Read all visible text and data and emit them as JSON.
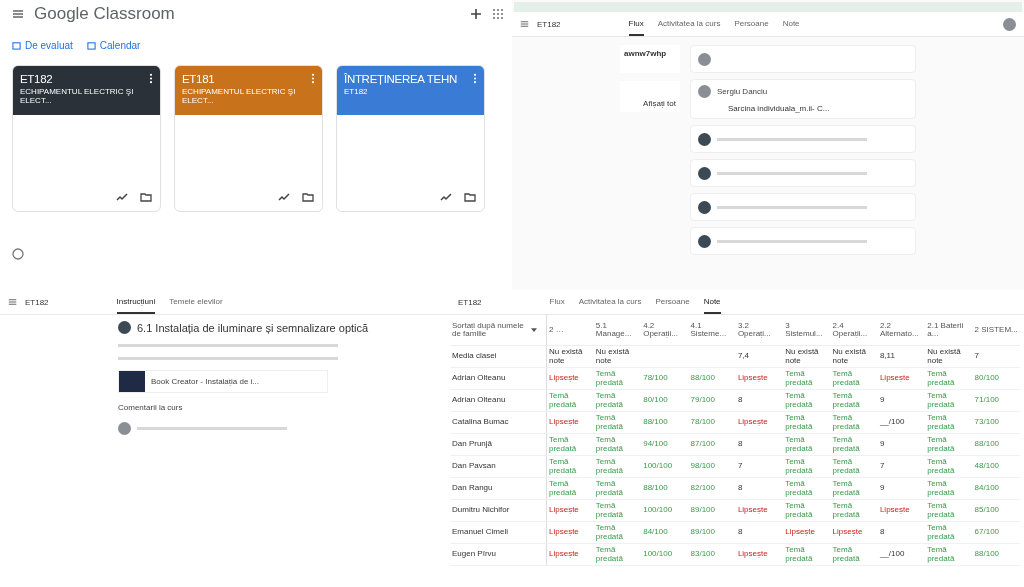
{
  "home": {
    "app_title": "Google Classroom",
    "links": [
      "De evaluat",
      "Calendar"
    ],
    "cards": [
      {
        "title": "ET182",
        "subtitle": "ECHIPAMENTUL ELECTRIC ŞI ELECT...",
        "color": "#2b3138"
      },
      {
        "title": "ET181",
        "subtitle": "ECHIPAMENTUL ELECTRIC ŞI ELECT...",
        "color": "#c8731c"
      },
      {
        "title": "ÎNTREȚINEREA TEHN",
        "subtitle": "ET182",
        "color": "#3a7bd5"
      }
    ]
  },
  "stream": {
    "class_name": "ET182",
    "tabs": [
      {
        "label": "Flux",
        "selected": true
      },
      {
        "label": "Activitatea la curs",
        "selected": false
      },
      {
        "label": "Persoane",
        "selected": false
      },
      {
        "label": "Note",
        "selected": false
      }
    ],
    "class_code": "awnw7whp",
    "view_all": "Afișați tot",
    "post_author": "Sergiu Danciu",
    "attachment": "Sarcina individuala_m.ii- C..."
  },
  "assignment": {
    "class_name": "ET182",
    "tabs": [
      {
        "label": "Instrucțiuni",
        "selected": true
      },
      {
        "label": "Temele elevilor",
        "selected": false
      }
    ],
    "title": "6.1 Instalația de iluminare și semnalizare optică",
    "material": "Book Creator - Instalația de i...",
    "comments": "Comentarii la curs"
  },
  "grades": {
    "class_name": "ET182",
    "tabs": [
      {
        "label": "Flux",
        "selected": false
      },
      {
        "label": "Activitatea la curs",
        "selected": false
      },
      {
        "label": "Persoane",
        "selected": false
      },
      {
        "label": "Note",
        "selected": true
      }
    ],
    "sort": "Sortați după numele de familie",
    "columns": [
      "2 …",
      "5.1 Manage...",
      "4.2 Operații...",
      "4.1 Sisteme...",
      "3.2 Operați...",
      "3 Sistemul...",
      "2.4 Operații...",
      "2.2 Alternato...",
      "2.1 Baterii a...",
      "2 SISTEM..."
    ],
    "rows": [
      {
        "name": "Media clasei",
        "cells": [
          {
            "text": "Nu există note",
            "kind": "plain"
          },
          {
            "text": "Nu există note",
            "kind": "plain"
          },
          {
            "text": "",
            "kind": "plain"
          },
          {
            "text": "",
            "kind": "plain"
          },
          {
            "text": "7,4",
            "kind": "plain"
          },
          {
            "text": "Nu există note",
            "kind": "plain"
          },
          {
            "text": "Nu există note",
            "kind": "plain"
          },
          {
            "text": "8,11",
            "kind": "plain"
          },
          {
            "text": "Nu există note",
            "kind": "plain"
          },
          {
            "text": "7",
            "kind": "plain"
          }
        ]
      },
      {
        "name": "Adrian Olteanu",
        "cells": [
          {
            "text": "Lipsește",
            "kind": "missing"
          },
          {
            "text": "Temă predată",
            "kind": "done"
          },
          {
            "text": "78/100",
            "kind": "done"
          },
          {
            "text": "88/100",
            "kind": "done"
          },
          {
            "text": "Lipsește",
            "kind": "missing"
          },
          {
            "text": "Temă predată",
            "kind": "done"
          },
          {
            "text": "Temă predată",
            "kind": "done"
          },
          {
            "text": "Lipsește",
            "kind": "missing"
          },
          {
            "text": "Temă predată",
            "kind": "done"
          },
          {
            "text": "80/100",
            "kind": "done"
          }
        ]
      },
      {
        "name": "Adrian Olteanu",
        "cells": [
          {
            "text": "Temă predată",
            "kind": "done"
          },
          {
            "text": "Temă predată",
            "kind": "done"
          },
          {
            "text": "80/100",
            "kind": "done"
          },
          {
            "text": "79/100",
            "kind": "done"
          },
          {
            "text": "8",
            "kind": "plain"
          },
          {
            "text": "Temă predată",
            "kind": "done"
          },
          {
            "text": "Temă predată",
            "kind": "done"
          },
          {
            "text": "9",
            "kind": "plain"
          },
          {
            "text": "Temă predată",
            "kind": "done"
          },
          {
            "text": "71/100",
            "kind": "done"
          }
        ]
      },
      {
        "name": "Catalina Bumac",
        "cells": [
          {
            "text": "Lipsește",
            "kind": "missing"
          },
          {
            "text": "Temă predată",
            "kind": "done"
          },
          {
            "text": "88/100",
            "kind": "done"
          },
          {
            "text": "78/100",
            "kind": "done"
          },
          {
            "text": "Lipsește",
            "kind": "missing"
          },
          {
            "text": "Temă predată",
            "kind": "done"
          },
          {
            "text": "Temă predată",
            "kind": "done"
          },
          {
            "text": "__/100",
            "kind": "plain"
          },
          {
            "text": "Temă predată",
            "kind": "done"
          },
          {
            "text": "73/100",
            "kind": "done"
          }
        ]
      },
      {
        "name": "Dan Prunjă",
        "cells": [
          {
            "text": "Temă predată",
            "kind": "done"
          },
          {
            "text": "Temă predată",
            "kind": "done"
          },
          {
            "text": "94/100",
            "kind": "done"
          },
          {
            "text": "87/100",
            "kind": "done"
          },
          {
            "text": "8",
            "kind": "plain"
          },
          {
            "text": "Temă predată",
            "kind": "done"
          },
          {
            "text": "Temă predată",
            "kind": "done"
          },
          {
            "text": "9",
            "kind": "plain"
          },
          {
            "text": "Temă predată",
            "kind": "done"
          },
          {
            "text": "88/100",
            "kind": "done"
          }
        ]
      },
      {
        "name": "Dan Pavsan",
        "cells": [
          {
            "text": "Temă predată",
            "kind": "done"
          },
          {
            "text": "Temă predată",
            "kind": "done"
          },
          {
            "text": "100/100",
            "kind": "done"
          },
          {
            "text": "98/100",
            "kind": "done"
          },
          {
            "text": "7",
            "kind": "plain"
          },
          {
            "text": "Temă predată",
            "kind": "done"
          },
          {
            "text": "Temă predată",
            "kind": "done"
          },
          {
            "text": "7",
            "kind": "plain"
          },
          {
            "text": "Temă predată",
            "kind": "done"
          },
          {
            "text": "48/100",
            "kind": "done"
          }
        ]
      },
      {
        "name": "Dan Rangu",
        "cells": [
          {
            "text": "Temă predată",
            "kind": "done"
          },
          {
            "text": "Temă predată",
            "kind": "done"
          },
          {
            "text": "88/100",
            "kind": "done"
          },
          {
            "text": "82/100",
            "kind": "done"
          },
          {
            "text": "8",
            "kind": "plain"
          },
          {
            "text": "Temă predată",
            "kind": "done"
          },
          {
            "text": "Temă predată",
            "kind": "done"
          },
          {
            "text": "9",
            "kind": "plain"
          },
          {
            "text": "Temă predată",
            "kind": "done"
          },
          {
            "text": "84/100",
            "kind": "done"
          }
        ]
      },
      {
        "name": "Dumitru Nichifor",
        "cells": [
          {
            "text": "Lipsește",
            "kind": "missing"
          },
          {
            "text": "Temă predată",
            "kind": "done"
          },
          {
            "text": "100/100",
            "kind": "done"
          },
          {
            "text": "89/100",
            "kind": "done"
          },
          {
            "text": "Lipsește",
            "kind": "missing"
          },
          {
            "text": "Temă predată",
            "kind": "done"
          },
          {
            "text": "Temă predată",
            "kind": "done"
          },
          {
            "text": "Lipsește",
            "kind": "missing"
          },
          {
            "text": "Temă predată",
            "kind": "done"
          },
          {
            "text": "85/100",
            "kind": "done"
          }
        ]
      },
      {
        "name": "Emanuel Cimeli",
        "cells": [
          {
            "text": "Lipsește",
            "kind": "missing"
          },
          {
            "text": "Temă predată",
            "kind": "done"
          },
          {
            "text": "84/100",
            "kind": "done"
          },
          {
            "text": "89/100",
            "kind": "done"
          },
          {
            "text": "8",
            "kind": "plain"
          },
          {
            "text": "Lipsește",
            "kind": "missing"
          },
          {
            "text": "Lipsește",
            "kind": "missing"
          },
          {
            "text": "8",
            "kind": "plain"
          },
          {
            "text": "Temă predată",
            "kind": "done"
          },
          {
            "text": "67/100",
            "kind": "done"
          }
        ]
      },
      {
        "name": "Eugen Pîrvu",
        "cells": [
          {
            "text": "Lipsește",
            "kind": "missing"
          },
          {
            "text": "Temă predată",
            "kind": "done"
          },
          {
            "text": "100/100",
            "kind": "done"
          },
          {
            "text": "83/100",
            "kind": "done"
          },
          {
            "text": "Lipsește",
            "kind": "missing"
          },
          {
            "text": "Temă predată",
            "kind": "done"
          },
          {
            "text": "Temă predată",
            "kind": "done"
          },
          {
            "text": "__/100",
            "kind": "plain"
          },
          {
            "text": "Temă predată",
            "kind": "done"
          },
          {
            "text": "88/100",
            "kind": "done"
          }
        ]
      }
    ]
  }
}
